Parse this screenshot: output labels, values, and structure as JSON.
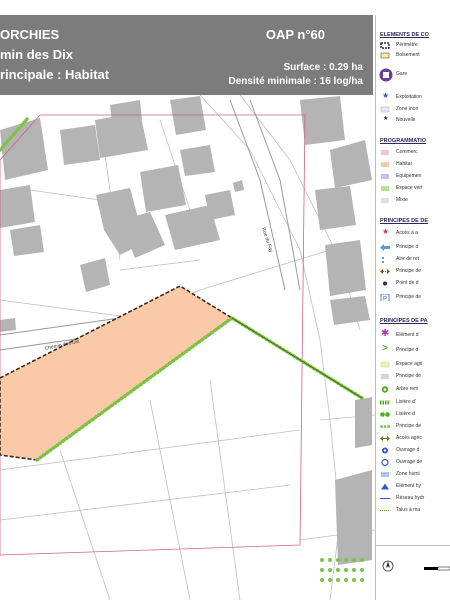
{
  "header": {
    "title_line1": "ORCHIES",
    "title_line2": "min des Dix",
    "title_line3": "rincipale : Habitat",
    "oap_number": "OAP n°60",
    "surface": "Surface : 0.29 ha",
    "density": "Densité minimale : 16 log/ha"
  },
  "map": {
    "street_label_1": "Chemin des Dix",
    "street_label_2": "Rue du Fay"
  },
  "colors": {
    "header_bg": "#7c7c7c",
    "habitat_fill": "#f9c9a8",
    "hedge_green": "#7dc242",
    "building_gray": "#b4b4b4",
    "perimeter_pink": "#d0608a"
  },
  "legend": {
    "sections": [
      {
        "title": "ELEMENTS DE CO",
        "items": [
          {
            "icon": "dashed-square-icon",
            "label": "Périmètre"
          },
          {
            "icon": "yellow-square-icon",
            "label": "Boisement"
          },
          {
            "icon": "train-station-icon",
            "label": "Gare"
          },
          {
            "icon": "star-icon",
            "label": "Exploitation"
          },
          {
            "icon": "zone-icon",
            "label": "Zone inon"
          },
          {
            "icon": "small-star-icon",
            "label": "Nouvelle"
          }
        ]
      },
      {
        "title": "PROGRAMMATIO",
        "items": [
          {
            "icon": "commerce-swatch-icon",
            "label": "Commerc"
          },
          {
            "icon": "habitat-swatch-icon",
            "label": "Habitat"
          },
          {
            "icon": "equipment-swatch-icon",
            "label": "Equipemen"
          },
          {
            "icon": "green-space-swatch-icon",
            "label": "Espace vert"
          },
          {
            "icon": "mixed-swatch-icon",
            "label": "Mixte"
          }
        ]
      },
      {
        "title": "PRINCIPES DE DE",
        "items": [
          {
            "icon": "access-star-icon",
            "label": "Accès à a"
          },
          {
            "icon": "arrow-left-icon",
            "label": "Principe d"
          },
          {
            "icon": "turnaround-icon",
            "label": "Aire de ret"
          },
          {
            "icon": "double-arrow-icon",
            "label": "Principe de"
          },
          {
            "icon": "point-icon",
            "label": "Point de d"
          },
          {
            "icon": "parking-icon",
            "label": "Principe de"
          }
        ]
      },
      {
        "title": "PRINCIPES DE PA",
        "items": [
          {
            "icon": "asterisk-icon",
            "label": "Elément d"
          },
          {
            "icon": "chevron-icon",
            "label": "Principe d"
          },
          {
            "icon": "yellow-swatch-icon",
            "label": "Espace agri"
          },
          {
            "icon": "gray-swatch-icon",
            "label": "Principe de"
          },
          {
            "icon": "tree-icon",
            "label": "Arbre rem"
          },
          {
            "icon": "hedge-icon",
            "label": "Lisière d'"
          },
          {
            "icon": "double-circle-icon",
            "label": "Lisière d"
          },
          {
            "icon": "dotted-hedge-icon",
            "label": "Principe de"
          },
          {
            "icon": "bidirectional-icon",
            "label": "Accès agric"
          },
          {
            "icon": "blue-circle-icon",
            "label": "Ouvrage d"
          },
          {
            "icon": "blue-circle-2-icon",
            "label": "Ouvrage de"
          },
          {
            "icon": "light-blue-swatch-icon",
            "label": "Zone humi"
          },
          {
            "icon": "triangle-icon",
            "label": "Elément hy"
          },
          {
            "icon": "blue-line-icon",
            "label": "Réseau hydr"
          },
          {
            "icon": "dotted-line-icon",
            "label": "Talus à ma"
          }
        ]
      }
    ]
  }
}
